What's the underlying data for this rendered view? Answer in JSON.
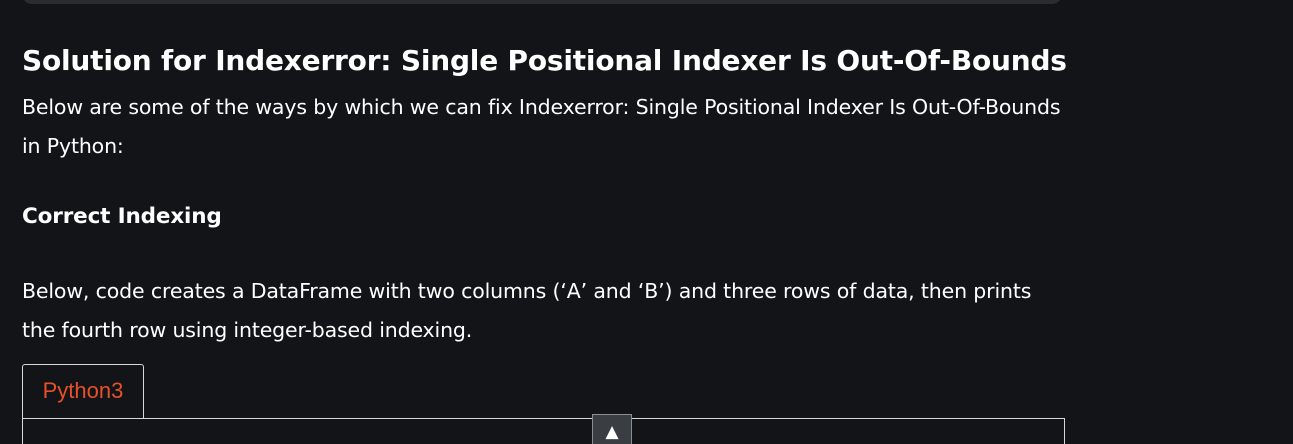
{
  "article": {
    "section_title": "Solution for Indexerror: Single Positional Indexer Is Out-Of-Bounds",
    "intro": "Below are some of the ways by which we can fix Indexerror: Single Positional Indexer Is Out-Of-Bounds in Python:",
    "subsection_title": "Correct Indexing",
    "description": "Below, code creates a DataFrame with two columns (‘A’ and ‘B’) and three rows of data, then prints the fourth row using integer-based indexing."
  },
  "code_block": {
    "tab_label": "Python3",
    "tab_color": "#e8502a",
    "toggle_icon": "▲"
  }
}
